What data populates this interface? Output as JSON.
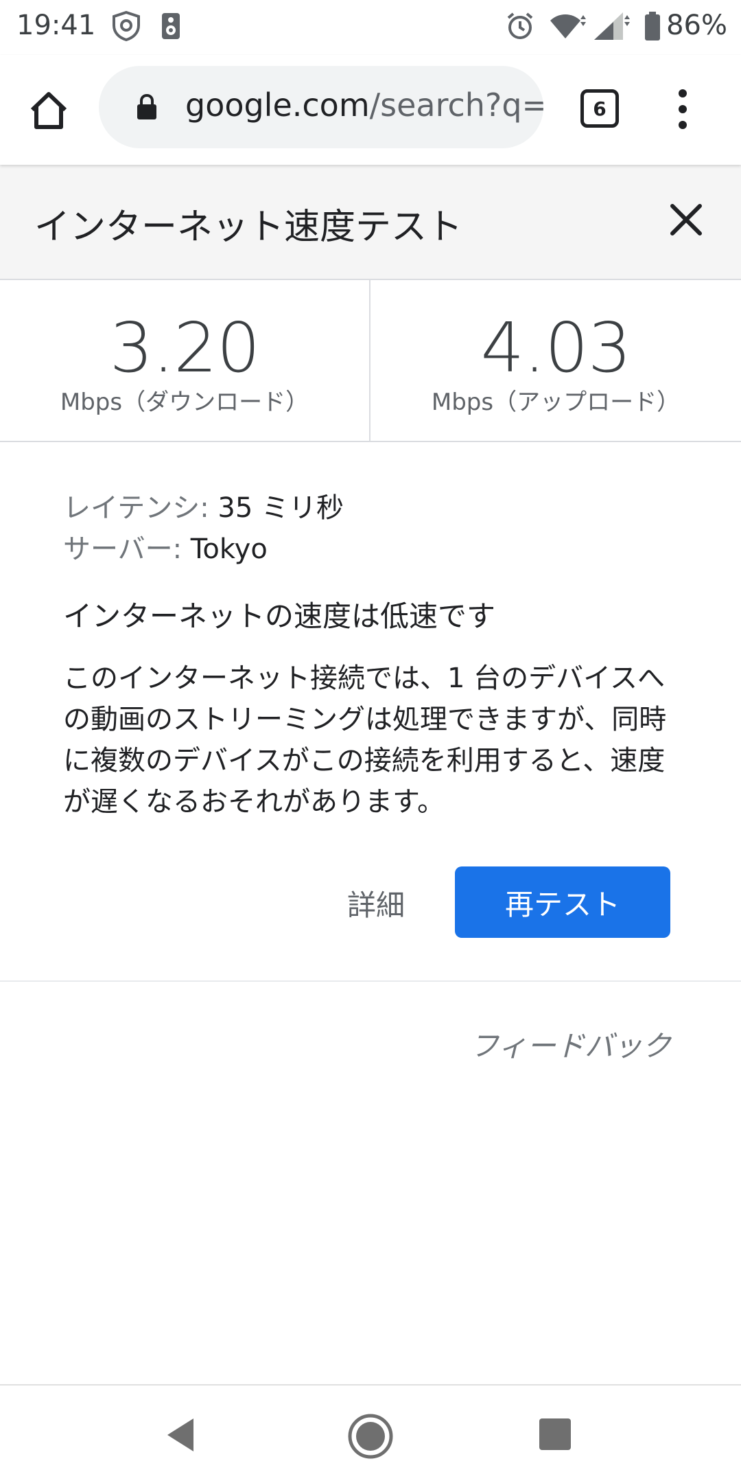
{
  "status_bar": {
    "time": "19:41",
    "battery": "86%",
    "icons": [
      "shield-icon",
      "speaker-icon",
      "alarm-icon",
      "wifi-icon",
      "signal-icon",
      "battery-icon"
    ]
  },
  "browser": {
    "url_host": "google.com",
    "url_path": "/search?q=",
    "tab_count": "6",
    "icons": [
      "home-icon",
      "lock-icon",
      "tabs-icon",
      "more-vert-icon"
    ]
  },
  "card": {
    "title": "インターネット速度テスト",
    "close_icon": "close-icon"
  },
  "results": {
    "download": {
      "value": "3.20",
      "unit": "Mbps（ダウンロード）"
    },
    "upload": {
      "value": "4.03",
      "unit": "Mbps（アップロード）"
    }
  },
  "details": {
    "latency_label": "レイテンシ:",
    "latency_value": " 35 ミリ秒",
    "server_label": "サーバー:",
    "server_value": " Tokyo",
    "summary": "インターネットの速度は低速です",
    "description": "このインターネット接続では、1 台のデバイスへの動画のストリーミングは処理できますが、同時に複数のデバイスがこの接続を利用すると、速度が遅くなるおそれがあります。"
  },
  "actions": {
    "details_label": "詳細",
    "retest_label": "再テスト",
    "feedback_label": "フィードバック"
  },
  "colors": {
    "accent": "#1a73e8",
    "header_bg": "#f5f5f5"
  },
  "nav_bar": {
    "icons": [
      "back-icon",
      "home-circle-icon",
      "recents-icon"
    ]
  }
}
